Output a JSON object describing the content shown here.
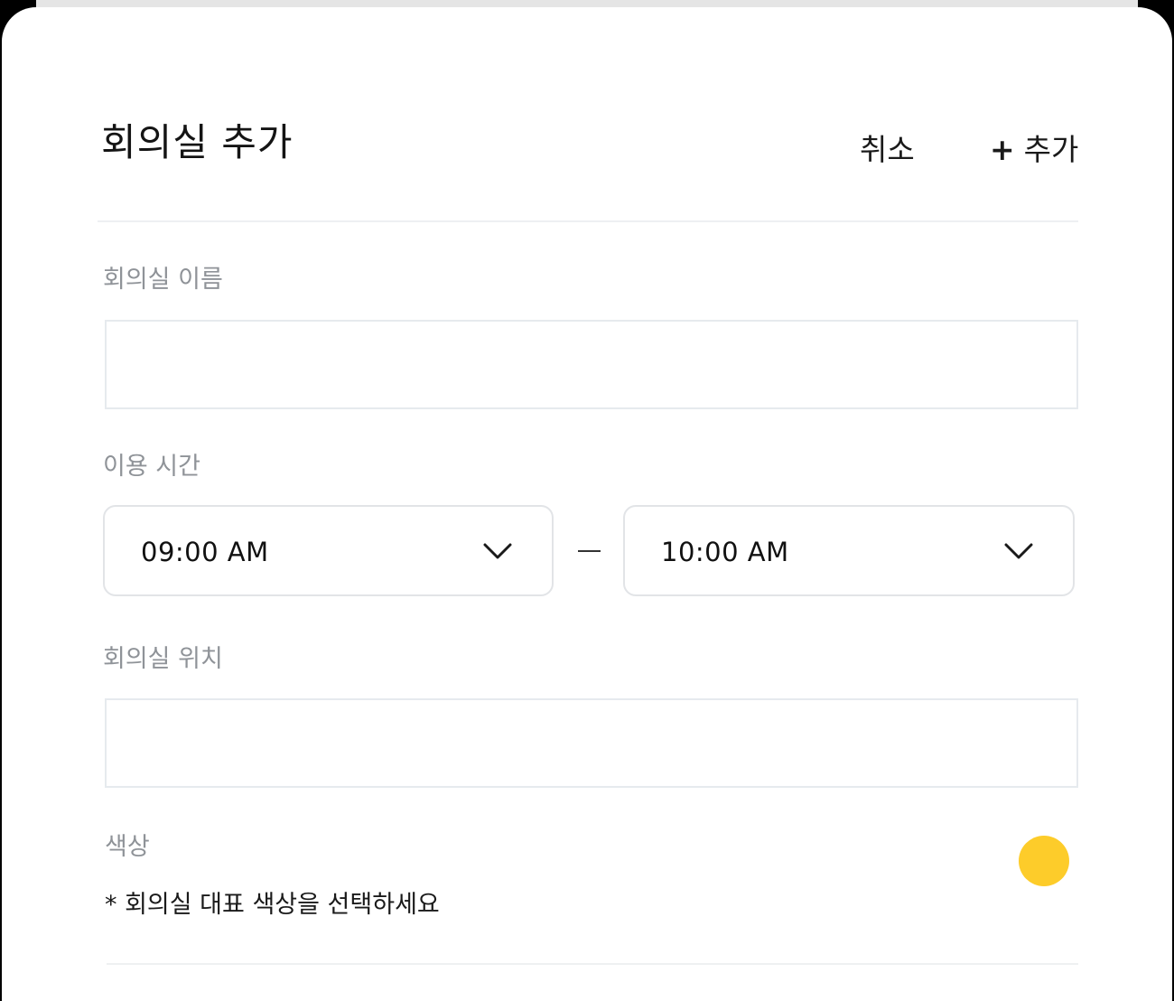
{
  "header": {
    "title": "회의실 추가",
    "cancel_label": "취소",
    "add_plus": "+",
    "add_label": "추가"
  },
  "form": {
    "name": {
      "label": "회의실 이름",
      "value": ""
    },
    "time": {
      "label": "이용 시간",
      "start": "09:00 AM",
      "end": "10:00 AM",
      "separator_icon": "dash-icon",
      "dropdown_icon": "chevron-down-icon"
    },
    "location": {
      "label": "회의실 위치",
      "value": ""
    },
    "color": {
      "label": "색상",
      "hint": "* 회의실 대표 색상을 선택하세요",
      "selected": "#FDCC2A"
    }
  },
  "colors": {
    "backdrop": "#000000",
    "sheet": "#FFFFFF",
    "label_gray": "#8F9398",
    "border": "#E6EAEE",
    "selected_swatch": "#FDCC2A"
  }
}
